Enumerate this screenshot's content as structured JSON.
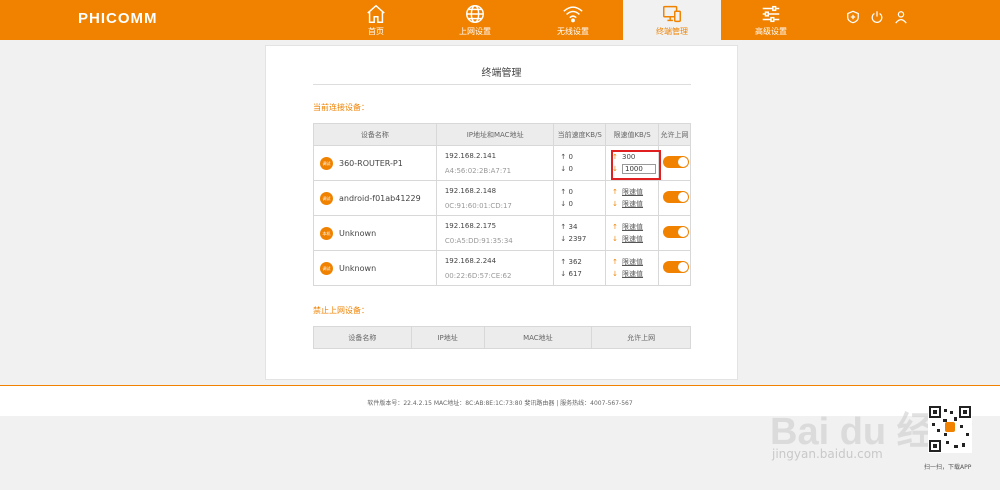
{
  "header": {
    "logo": "PHICOMM",
    "nav": [
      {
        "label": "首页",
        "icon": "home-icon"
      },
      {
        "label": "上网设置",
        "icon": "globe-icon"
      },
      {
        "label": "无线设置",
        "icon": "wifi-icon"
      },
      {
        "label": "终端管理",
        "icon": "devices-icon",
        "active": true
      },
      {
        "label": "高级设置",
        "icon": "sliders-icon"
      }
    ],
    "right_icons": [
      "add-icon",
      "power-icon",
      "user-icon"
    ]
  },
  "page": {
    "title": "终端管理",
    "connected_title": "当前连接设备：",
    "blocked_title": "禁止上网设备："
  },
  "connected_table": {
    "headers": [
      "设备名称",
      "IP地址和MAC地址",
      "当前速度KB/S",
      "限速值KB/S",
      "允许上网"
    ],
    "rows": [
      {
        "badge": "调试",
        "name": "360-ROUTER-P1",
        "ip": "192.168.2.141",
        "mac": "A4:56:02:2B:A7:71",
        "up": "↑ 0",
        "down": "↓ 0",
        "limit_up": "300",
        "limit_down": "1000",
        "limit_label": ""
      },
      {
        "badge": "调试",
        "name": "android-f01ab41229",
        "ip": "192.168.2.148",
        "mac": "0C:91:60:01:CD:17",
        "up": "↑ 0",
        "down": "↓ 0",
        "limit_label": "限速值"
      },
      {
        "badge": "本机",
        "name": "Unknown",
        "ip": "192.168.2.175",
        "mac": "C0:A5:DD:91:35:34",
        "up": "↑ 34",
        "down": "↓ 2397",
        "limit_label": "限速值"
      },
      {
        "badge": "调试",
        "name": "Unknown",
        "ip": "192.168.2.244",
        "mac": "00:22:6D:57:CE:62",
        "up": "↑ 362",
        "down": "↓ 617",
        "limit_label": "限速值"
      }
    ],
    "allow_state": "on"
  },
  "blocked_table": {
    "headers": [
      "设备名称",
      "IP地址",
      "MAC地址",
      "允许上网"
    ]
  },
  "footer": {
    "text": "软件版本号：22.4.2.15    MAC地址：8C:AB:8E:1C:73:80    斐讯路由器 | 服务热线：4007-567-567"
  },
  "watermark": {
    "brand": "Bai du 经验",
    "url": "jingyan.baidu.com",
    "qr_caption": "扫一扫，下载APP"
  },
  "colors": {
    "accent": "#f08200",
    "highlight": "#e02020"
  }
}
